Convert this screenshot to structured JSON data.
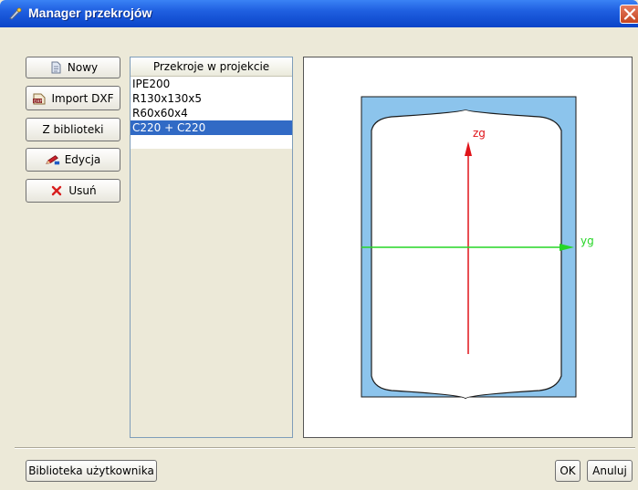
{
  "window": {
    "title": "Manager przekrojów"
  },
  "toolbar": {
    "new_label": "Nowy",
    "import_label": "Import DXF",
    "library_label": "Z biblioteki",
    "edit_label": "Edycja",
    "delete_label": "Usuń"
  },
  "sections": {
    "header": "Przekroje w projekcie",
    "items": [
      "IPE200",
      "R130x130x5",
      "R60x60x4",
      "C220 + C220"
    ],
    "selected": "C220 + C220"
  },
  "preview": {
    "axis_z_label": "zg",
    "axis_y_label": "yg",
    "colors": {
      "fill": "#8cc4ec",
      "axis_z": "#e0141a",
      "axis_y": "#27d627",
      "outline": "#1a1a1a"
    }
  },
  "footer": {
    "user_library_label": "Biblioteka użytkownika",
    "ok_label": "OK",
    "cancel_label": "Anuluj"
  },
  "icons": [
    "app-icon",
    "close-icon",
    "new-doc-icon",
    "dxf-icon",
    "pencil-icon",
    "delete-x-icon"
  ]
}
